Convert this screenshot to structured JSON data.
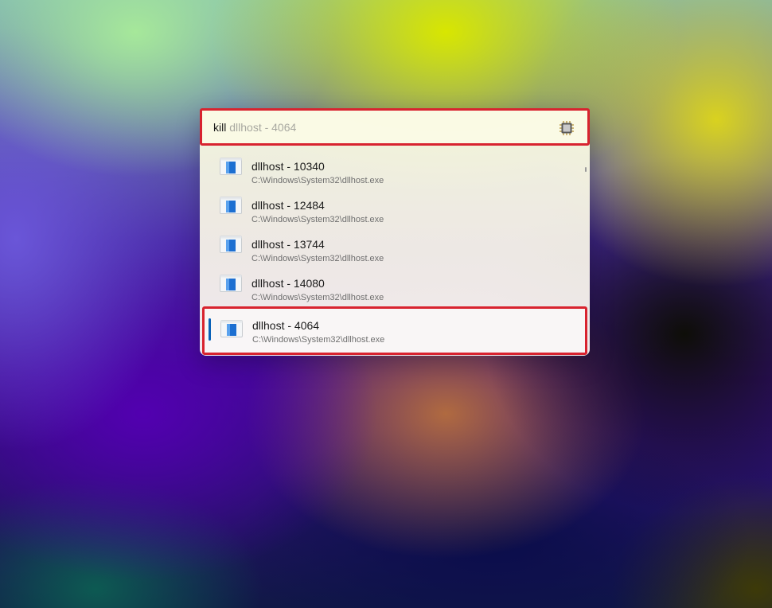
{
  "search": {
    "query": "kill ",
    "autocomplete_suggestion": "dllhost - 4064",
    "plugin_icon": "processor-chip-icon"
  },
  "results": [
    {
      "title": "dllhost - 10340",
      "path": "C:\\Windows\\System32\\dllhost.exe",
      "icon": "app-window-icon"
    },
    {
      "title": "dllhost - 12484",
      "path": "C:\\Windows\\System32\\dllhost.exe",
      "icon": "app-window-icon"
    },
    {
      "title": "dllhost - 13744",
      "path": "C:\\Windows\\System32\\dllhost.exe",
      "icon": "app-window-icon"
    },
    {
      "title": "dllhost - 14080",
      "path": "C:\\Windows\\System32\\dllhost.exe",
      "icon": "app-window-icon"
    },
    {
      "title": "dllhost - 4064",
      "path": "C:\\Windows\\System32\\dllhost.exe",
      "icon": "app-window-icon",
      "selected": true
    }
  ],
  "colors": {
    "highlight_border": "#d8232f",
    "selection_accent": "#0a62b8"
  }
}
